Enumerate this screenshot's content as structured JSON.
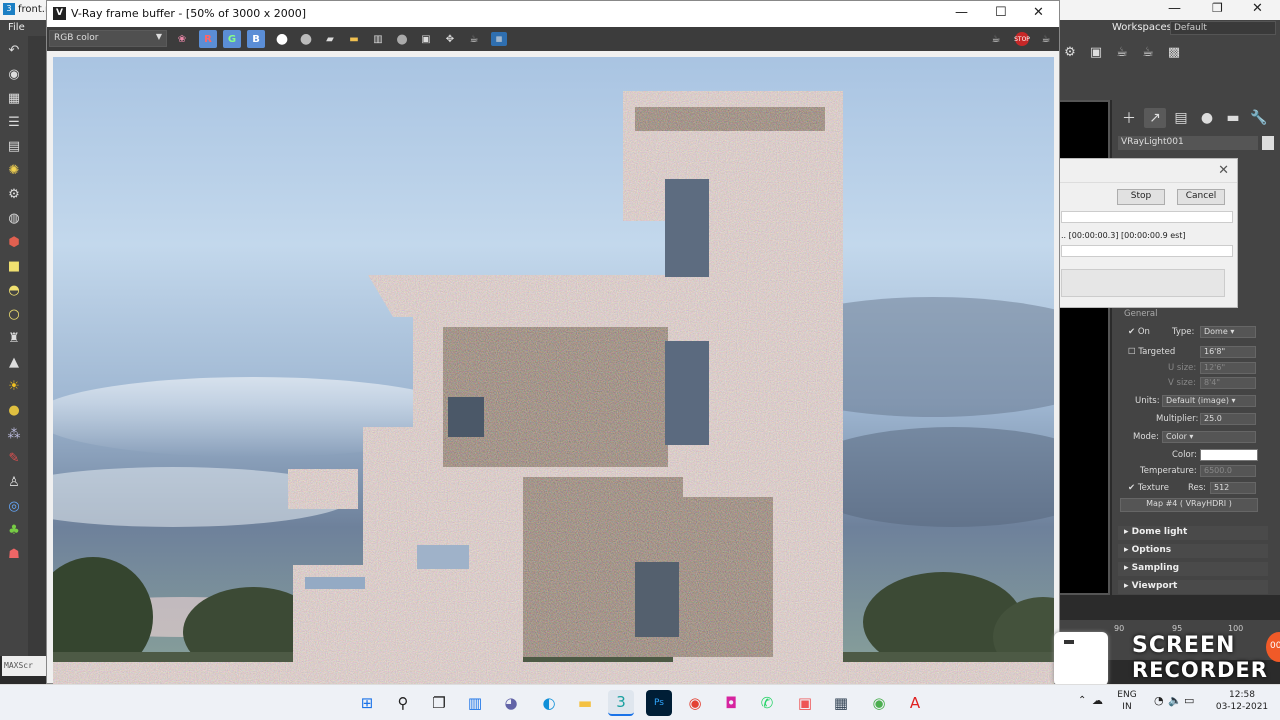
{
  "background_app": {
    "title_fragment": "front.m",
    "menu_file": "File",
    "maxscript_label": "MAXScr",
    "workspaces_label": "Workspaces:",
    "workspaces_value": "Default",
    "object_name": "VRayLight001"
  },
  "render_dialog": {
    "stop_label": "Stop",
    "cancel_label": "Cancel",
    "time_text": ".. [00:00:00.3] [00:00:00.9 est]"
  },
  "vfb": {
    "title": "V-Ray frame buffer - [50% of 3000 x 2000]",
    "channel": "RGB color",
    "r_label": "R",
    "g_label": "G",
    "b_label": "B",
    "stop_icon_label": "STOP"
  },
  "light_params": {
    "rollout_general": "General",
    "on_label": "On",
    "type_label": "Type:",
    "type_value": "Dome",
    "targeted_label": "Targeted",
    "targeted_value": "16'8\"",
    "usize_label": "U size:",
    "usize_value": "12'6\"",
    "vsize_label": "V size:",
    "vsize_value": "8'4\"",
    "units_label": "Units:",
    "units_value": "Default (image)",
    "multiplier_label": "Multiplier:",
    "multiplier_value": "25.0",
    "mode_label": "Mode:",
    "mode_value": "Color",
    "color_label": "Color:",
    "temperature_label": "Temperature:",
    "temperature_value": "6500.0",
    "texture_label": "Texture",
    "res_label": "Res:",
    "res_value": "512",
    "map_label": "Map #4  ( VRayHDRI )"
  },
  "rollouts": [
    "Dome light",
    "Options",
    "Sampling",
    "Viewport"
  ],
  "timeline": {
    "ticks": [
      "90",
      "95",
      "100"
    ]
  },
  "watermark": {
    "line1": "SCREEN",
    "line2": "RECORDER"
  },
  "taskbar": {
    "language_line1": "ENG",
    "language_line2": "IN",
    "time": "12:58",
    "date": "03-12-2021"
  },
  "colors": {
    "accent_blue": "#5b8ed6",
    "stop_red": "#c62828",
    "panel_dark": "#444444"
  }
}
